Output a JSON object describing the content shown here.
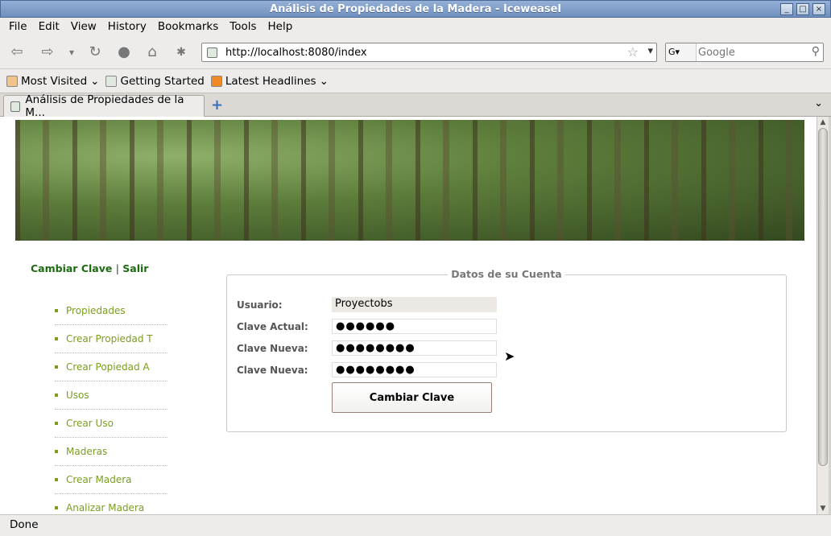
{
  "window": {
    "title": "Análisis de Propiedades de la Madera - Iceweasel"
  },
  "menubar": [
    "File",
    "Edit",
    "View",
    "History",
    "Bookmarks",
    "Tools",
    "Help"
  ],
  "navbar": {
    "url": "http://localhost:8080/index",
    "search_placeholder": "Google"
  },
  "bookmarks": [
    {
      "label": "Most Visited",
      "icon": "most-visited-icon"
    },
    {
      "label": "Getting Started",
      "icon": "page-icon"
    },
    {
      "label": "Latest Headlines",
      "icon": "rss-icon"
    }
  ],
  "tab": {
    "label": "Análisis de Propiedades de la M..."
  },
  "page": {
    "usernav": {
      "change": "Cambiar Clave",
      "sep": "|",
      "logout": "Salir"
    },
    "sidebar": [
      "Propiedades",
      "Crear Propiedad T",
      "Crear Popiedad A",
      "Usos",
      "Crear Uso",
      "Maderas",
      "Crear Madera",
      "Analizar Madera"
    ],
    "form": {
      "legend": "Datos de su Cuenta",
      "user_label": "Usuario:",
      "user_value": "Proyectobs",
      "current_label": "Clave Actual:",
      "current_mask": "●●●●●●",
      "new_label": "Clave Nueva:",
      "new_mask": "●●●●●●●●",
      "confirm_label": "Clave Nueva:",
      "confirm_mask": "●●●●●●●●",
      "submit": "Cambiar Clave"
    }
  },
  "status": "Done"
}
